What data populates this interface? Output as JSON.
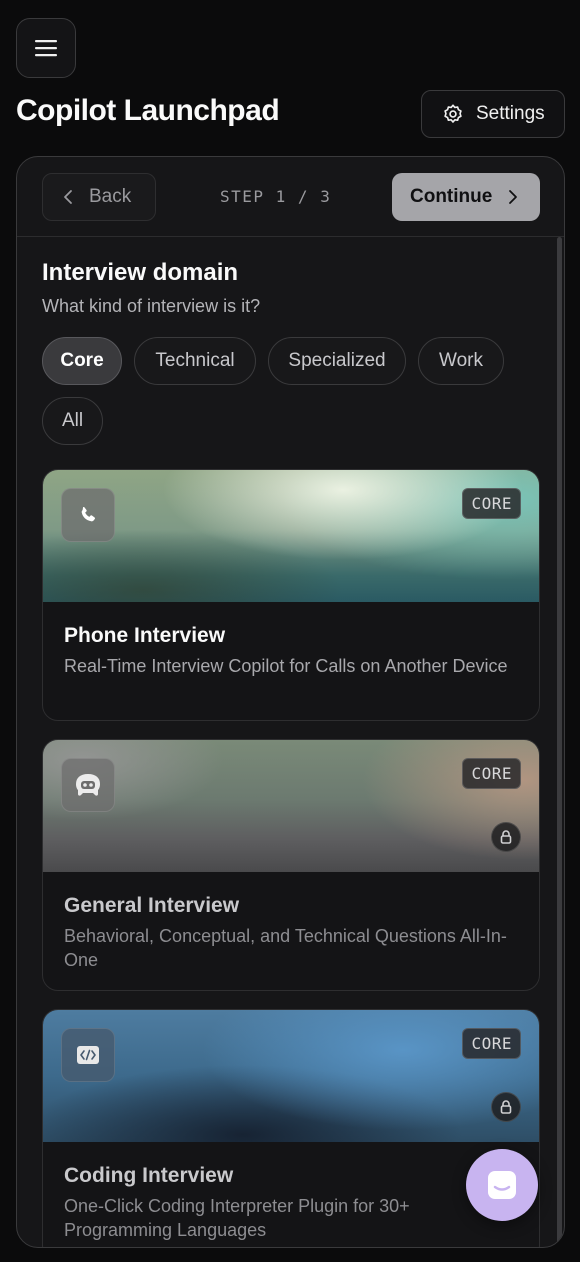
{
  "header": {
    "title": "Copilot Launchpad",
    "settings_label": "Settings"
  },
  "wizard": {
    "back_label": "Back",
    "step_text": "STEP 1 / 3",
    "continue_label": "Continue"
  },
  "section": {
    "title": "Interview domain",
    "subtitle": "What kind of interview is it?"
  },
  "filters": [
    {
      "label": "Core",
      "active": true
    },
    {
      "label": "Technical",
      "active": false
    },
    {
      "label": "Specialized",
      "active": false
    },
    {
      "label": "Work",
      "active": false
    },
    {
      "label": "All",
      "active": false
    }
  ],
  "cards": [
    {
      "title": "Phone Interview",
      "description": "Real-Time Interview Copilot for Calls on Another Device",
      "badge": "CORE",
      "icon": "phone-icon",
      "locked": false
    },
    {
      "title": "General Interview",
      "description": "Behavioral, Conceptual, and Technical Questions All-In-One",
      "badge": "CORE",
      "icon": "robot-icon",
      "locked": true
    },
    {
      "title": "Coding Interview",
      "description": "One-Click Coding Interpreter Plugin for 30+ Programming Languages",
      "badge": "CORE",
      "icon": "code-icon",
      "locked": true
    }
  ],
  "colors": {
    "background": "#0b0b0c",
    "panel": "#161618",
    "continue_button": "#a5a5a9",
    "chat_fab": "#c8b4f0"
  }
}
